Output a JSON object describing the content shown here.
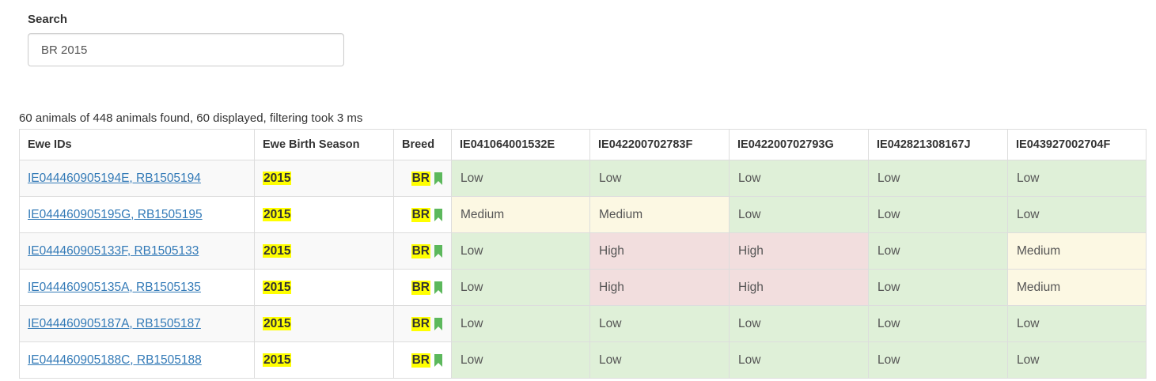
{
  "search": {
    "label": "Search",
    "value": "BR 2015"
  },
  "summary": "60 animals of 448 animals found, 60 displayed, filtering took 3 ms",
  "columns": [
    "Ewe IDs",
    "Ewe Birth Season",
    "Breed",
    "IE041064001532E",
    "IE042200702783F",
    "IE042200702793G",
    "IE042821308167J",
    "IE043927002704F"
  ],
  "rows": [
    {
      "ids": "IE044460905194E, RB1505194",
      "season": "2015",
      "breed": "BR",
      "levels": [
        "Low",
        "Low",
        "Low",
        "Low",
        "Low"
      ]
    },
    {
      "ids": "IE044460905195G, RB1505195",
      "season": "2015",
      "breed": "BR",
      "levels": [
        "Medium",
        "Medium",
        "Low",
        "Low",
        "Low"
      ]
    },
    {
      "ids": "IE044460905133F, RB1505133",
      "season": "2015",
      "breed": "BR",
      "levels": [
        "Low",
        "High",
        "High",
        "Low",
        "Medium"
      ]
    },
    {
      "ids": "IE044460905135A, RB1505135",
      "season": "2015",
      "breed": "BR",
      "levels": [
        "Low",
        "High",
        "High",
        "Low",
        "Medium"
      ]
    },
    {
      "ids": "IE044460905187A, RB1505187",
      "season": "2015",
      "breed": "BR",
      "levels": [
        "Low",
        "Low",
        "Low",
        "Low",
        "Low"
      ]
    },
    {
      "ids": "IE044460905188C, RB1505188",
      "season": "2015",
      "breed": "BR",
      "levels": [
        "Low",
        "Low",
        "Low",
        "Low",
        "Low"
      ]
    }
  ],
  "icons": {
    "breed_marker": "bookmark-icon"
  },
  "colors": {
    "link": "#337ab7",
    "highlight": "#ffff00",
    "bookmark": "#5cb85c",
    "low": "#dff0d8",
    "medium": "#fcf8e3",
    "high": "#f2dede"
  }
}
